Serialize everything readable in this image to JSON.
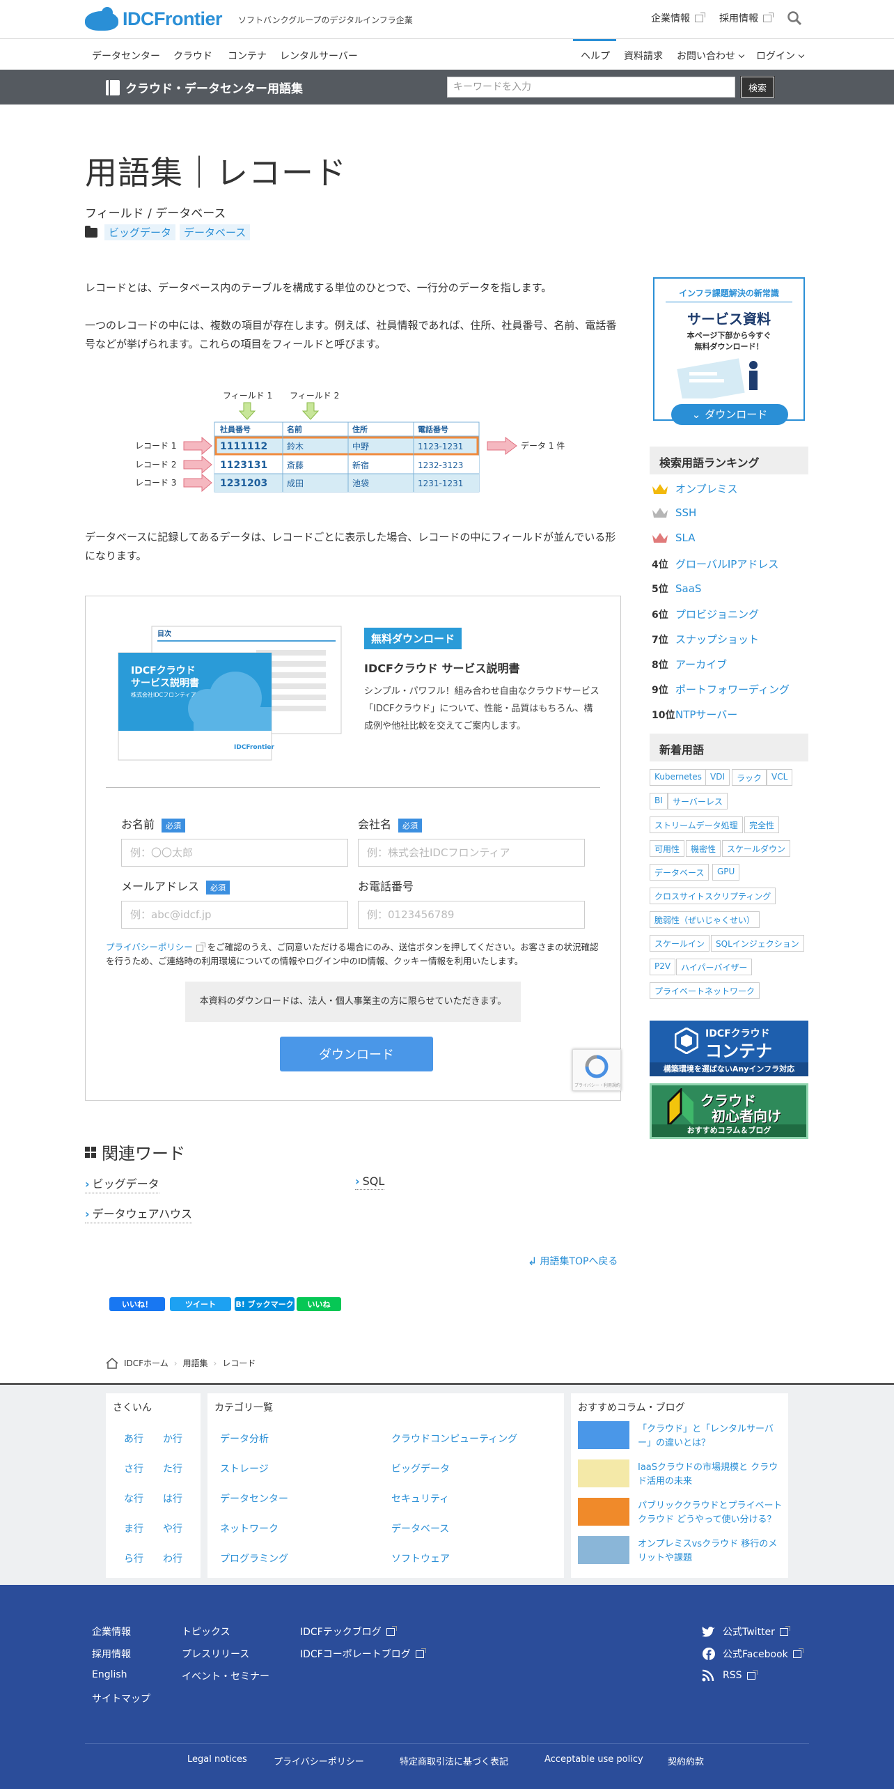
{
  "header": {
    "brand": "IDCFrontier",
    "tagline": "ソフトバンクグループのデジタルインフラ企業",
    "links": [
      "企業情報",
      "採用情報"
    ]
  },
  "nav": {
    "left": [
      "データセンター",
      "クラウド",
      "コンテナ",
      "レンタルサーバー"
    ],
    "right": [
      "ヘルプ",
      "資料請求",
      "お問い合わせ",
      "ログイン"
    ]
  },
  "glossary_bar": {
    "title": "クラウド・データセンター用語集",
    "placeholder": "キーワードを入力",
    "button": "検索"
  },
  "article": {
    "title": "用語集｜レコード",
    "subtitle": "フィールド / データベース",
    "tags": [
      "ビッグデータ",
      "データベース"
    ],
    "p1": "レコードとは、データベース内のテーブルを構成する単位のひとつで、一行分のデータを指します。",
    "p2": "一つのレコードの中には、複数の項目が存在します。例えば、社員情報であれば、住所、社員番号、名前、電話番号などが挙げられます。これらの項目をフィールドと呼びます。",
    "p3": "データベースに記録してあるデータは、レコードごとに表示した場合、レコードの中にフィールドが並んでいる形になります。"
  },
  "diagram": {
    "field1": "フィールド 1",
    "field2": "フィールド 2",
    "headers": [
      "社員番号",
      "名前",
      "住所",
      "電話番号"
    ],
    "rows": [
      [
        "1111112",
        "鈴木",
        "中野",
        "1123-1231"
      ],
      [
        "1123131",
        "斎藤",
        "新宿",
        "1232-3123"
      ],
      [
        "1231203",
        "成田",
        "池袋",
        "1231-1231"
      ]
    ],
    "record_labels": [
      "レコード 1",
      "レコード 2",
      "レコード 3"
    ],
    "data_label": "データ 1 件"
  },
  "form": {
    "doc_toc": "目次",
    "doc_title1": "IDCFクラウド",
    "doc_title2": "サービス説明書",
    "doc_company": "株式会社IDCフロンティア",
    "doc_brand": "IDCFrontier",
    "badge": "無料ダウンロード",
    "heading": "IDCFクラウド サービス説明書",
    "desc": "シンプル・パワフル！組み合わせ自由なクラウドサービス「IDCFクラウド」について、性能・品質はもちろん、構成例や他社比較を交えてご案内します。",
    "name_label": "お名前",
    "company_label": "会社名",
    "email_label": "メールアドレス",
    "phone_label": "お電話番号",
    "required": "必須",
    "name_ph": "例：〇〇太郎",
    "company_ph": "例：株式会社IDCフロンティア",
    "email_ph": "例：abc@idcf.jp",
    "phone_ph": "例：0123456789",
    "privacy_link": "プライバシーポリシー",
    "privacy_text": "をご確認のうえ、ご同意いただける場合にのみ、送信ボタンを押してください。お客さまの状況確認を行うため、ご連絡時の利用環境についての情報やログイン中のID情報、クッキー情報を利用いたします。",
    "notice": "本資料のダウンロードは、法人・個人事業主の方に限らせていただきます。",
    "button": "ダウンロード",
    "recaptcha": "プライバシー・利用規約"
  },
  "related": {
    "title": "関連ワード",
    "words": [
      "ビッグデータ",
      "SQL",
      "データウェアハウス"
    ],
    "back": "用語集TOPへ戻る"
  },
  "sns": [
    "いいね！",
    "ツイート",
    "B! ブックマーク",
    "いいね"
  ],
  "breadcrumb": [
    "IDCFホーム",
    "用語集",
    "レコード"
  ],
  "sidebar": {
    "banner_top": "インフラ課題解決の新常識",
    "banner_title": "サービス資料",
    "banner_sub1": "本ページ下部から今すぐ",
    "banner_sub2": "無料ダウンロード！",
    "banner_btn": "ダウンロード",
    "ranking_title": "検索用語ランキング",
    "ranking": [
      "オンプレミス",
      "SSH",
      "SLA",
      "グローバルIPアドレス",
      "SaaS",
      "プロビジョニング",
      "スナップショット",
      "アーカイブ",
      "ポートフォワーディング",
      "NTPサーバー"
    ],
    "ranks": [
      "4位",
      "5位",
      "6位",
      "7位",
      "8位",
      "9位",
      "10位"
    ],
    "new_title": "新着用語",
    "new_terms": [
      "Kubernetes",
      "VDI",
      "ラック",
      "VCL",
      "BI",
      "サーバーレス",
      "ストリームデータ処理",
      "完全性",
      "可用性",
      "機密性",
      "スケールダウン",
      "データベース",
      "GPU",
      "クロスサイトスクリプティング",
      "脆弱性（ぜいじゃくせい）",
      "スケールイン",
      "SQLインジェクション",
      "P2V",
      "ハイパーバイザー",
      "プライベートネットワーク"
    ],
    "ad1_title": "IDCFクラウド",
    "ad1_big": "コンテナ",
    "ad1_sub": "構築環境を選ばないAnyインフラ対応",
    "ad2_title": "クラウド",
    "ad2_big": "初心者向け",
    "ad2_sub": "おすすめコラム＆ブログ"
  },
  "footer_top": {
    "index_title": "さくいん",
    "kana": [
      "あ行",
      "か行",
      "さ行",
      "た行",
      "な行",
      "は行",
      "ま行",
      "や行",
      "ら行",
      "わ行"
    ],
    "cat_title": "カテゴリ一覧",
    "cats": [
      "データ分析",
      "クラウドコンピューティング",
      "ストレージ",
      "ビッグデータ",
      "データセンター",
      "セキュリティ",
      "ネットワーク",
      "データベース",
      "プログラミング",
      "ソフトウェア"
    ],
    "col_title": "おすすめコラム・ブログ",
    "columns": [
      "「クラウド」と「レンタルサーバー」の違いとは？",
      "IaaSクラウドの市場規模と クラウド活用の未来",
      "パブリッククラウドとプライベートクラウド どうやって使い分ける？",
      "オンプレミスvsクラウド 移行のメリットや課題"
    ]
  },
  "footer": {
    "col1": [
      "企業情報",
      "採用情報",
      "English",
      "サイトマップ"
    ],
    "col2": [
      "トピックス",
      "プレスリリース",
      "イベント・セミナー"
    ],
    "col3": [
      "IDCFテックブログ",
      "IDCFコーポレートブログ"
    ],
    "social": [
      "公式Twitter",
      "公式Facebook",
      "RSS"
    ],
    "bottom": [
      "Legal notices",
      "プライバシーポリシー",
      "特定商取引法に基づく表記",
      "Acceptable use policy",
      "契約約款"
    ]
  },
  "colors": {
    "accent": "#2a8fd6",
    "button": "#4a97e8",
    "footer": "#2b4d9a",
    "bar": "#555a60"
  }
}
